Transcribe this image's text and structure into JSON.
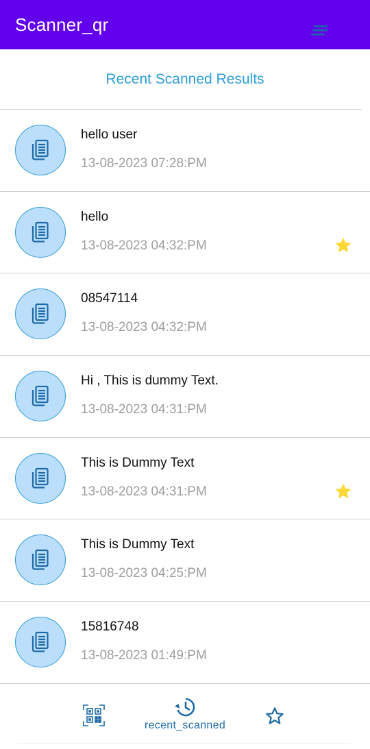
{
  "app": {
    "title": "Scanner_qr",
    "accent": "#6200EE",
    "link_color": "#2E9BD8"
  },
  "header": {
    "title": "Recent Scanned Results",
    "sort_icon": "sort-lines-icon"
  },
  "results": [
    {
      "text": "hello user",
      "date": "13-08-2023 07:28:PM",
      "favorite": false
    },
    {
      "text": "hello",
      "date": "13-08-2023 04:32:PM",
      "favorite": true
    },
    {
      "text": "08547114",
      "date": "13-08-2023 04:32:PM",
      "favorite": false
    },
    {
      "text": "Hi , This is dummy Text.",
      "date": "13-08-2023 04:31:PM",
      "favorite": false
    },
    {
      "text": "This is Dummy Text",
      "date": "13-08-2023 04:31:PM",
      "favorite": true
    },
    {
      "text": "This is Dummy Text",
      "date": "13-08-2023 04:25:PM",
      "favorite": false
    },
    {
      "text": "15816748",
      "date": "13-08-2023 01:49:PM",
      "favorite": false
    }
  ],
  "bottom_nav": {
    "items": [
      {
        "icon": "qr-scan-icon",
        "label": ""
      },
      {
        "icon": "history-icon",
        "label": "recent_scanned",
        "active": true
      },
      {
        "icon": "star-outline-icon",
        "label": ""
      }
    ]
  },
  "colors": {
    "star": "#FDD835",
    "avatar_bg": "#BBDEFB",
    "date_text": "#9e9e9e"
  }
}
